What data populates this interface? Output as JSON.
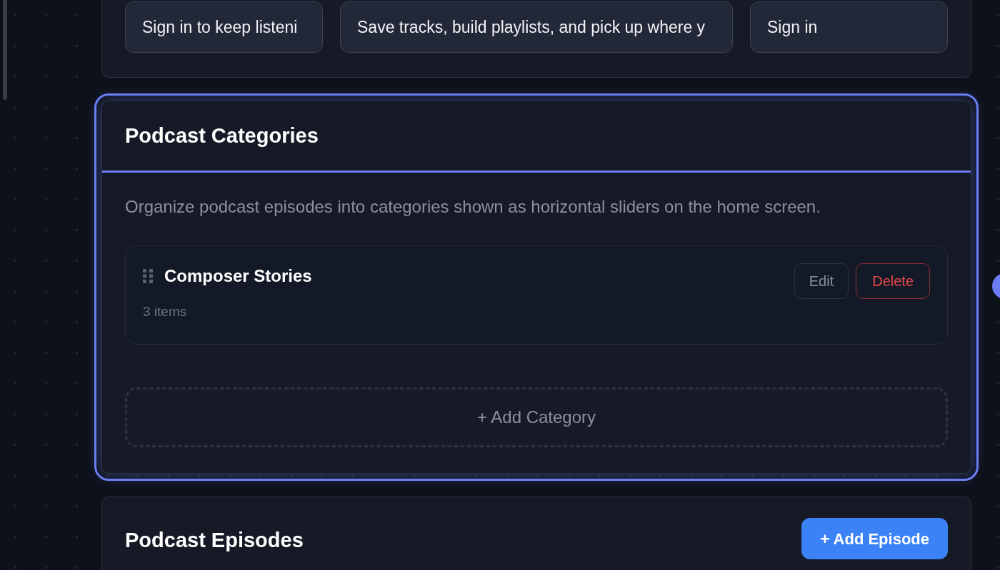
{
  "sections": [
    {
      "kind": "fields",
      "selected": false,
      "fields": [
        {
          "value": "Sign in to keep listeni"
        },
        {
          "value": "Save tracks, build playlists, and pick up where y"
        },
        {
          "value": "Sign in"
        }
      ]
    },
    {
      "kind": "categories",
      "selected": true,
      "title": "Podcast Categories",
      "description": "Organize podcast episodes into categories shown as horizontal sliders on the home screen.",
      "categories": [
        {
          "name": "Composer Stories",
          "count": "3 items",
          "edit_label": "Edit",
          "delete_label": "Delete"
        }
      ],
      "add_label": "+ Add Category"
    },
    {
      "kind": "episodes",
      "selected": false,
      "title": "Podcast Episodes",
      "add_label": "+ Add Episode"
    }
  ]
}
